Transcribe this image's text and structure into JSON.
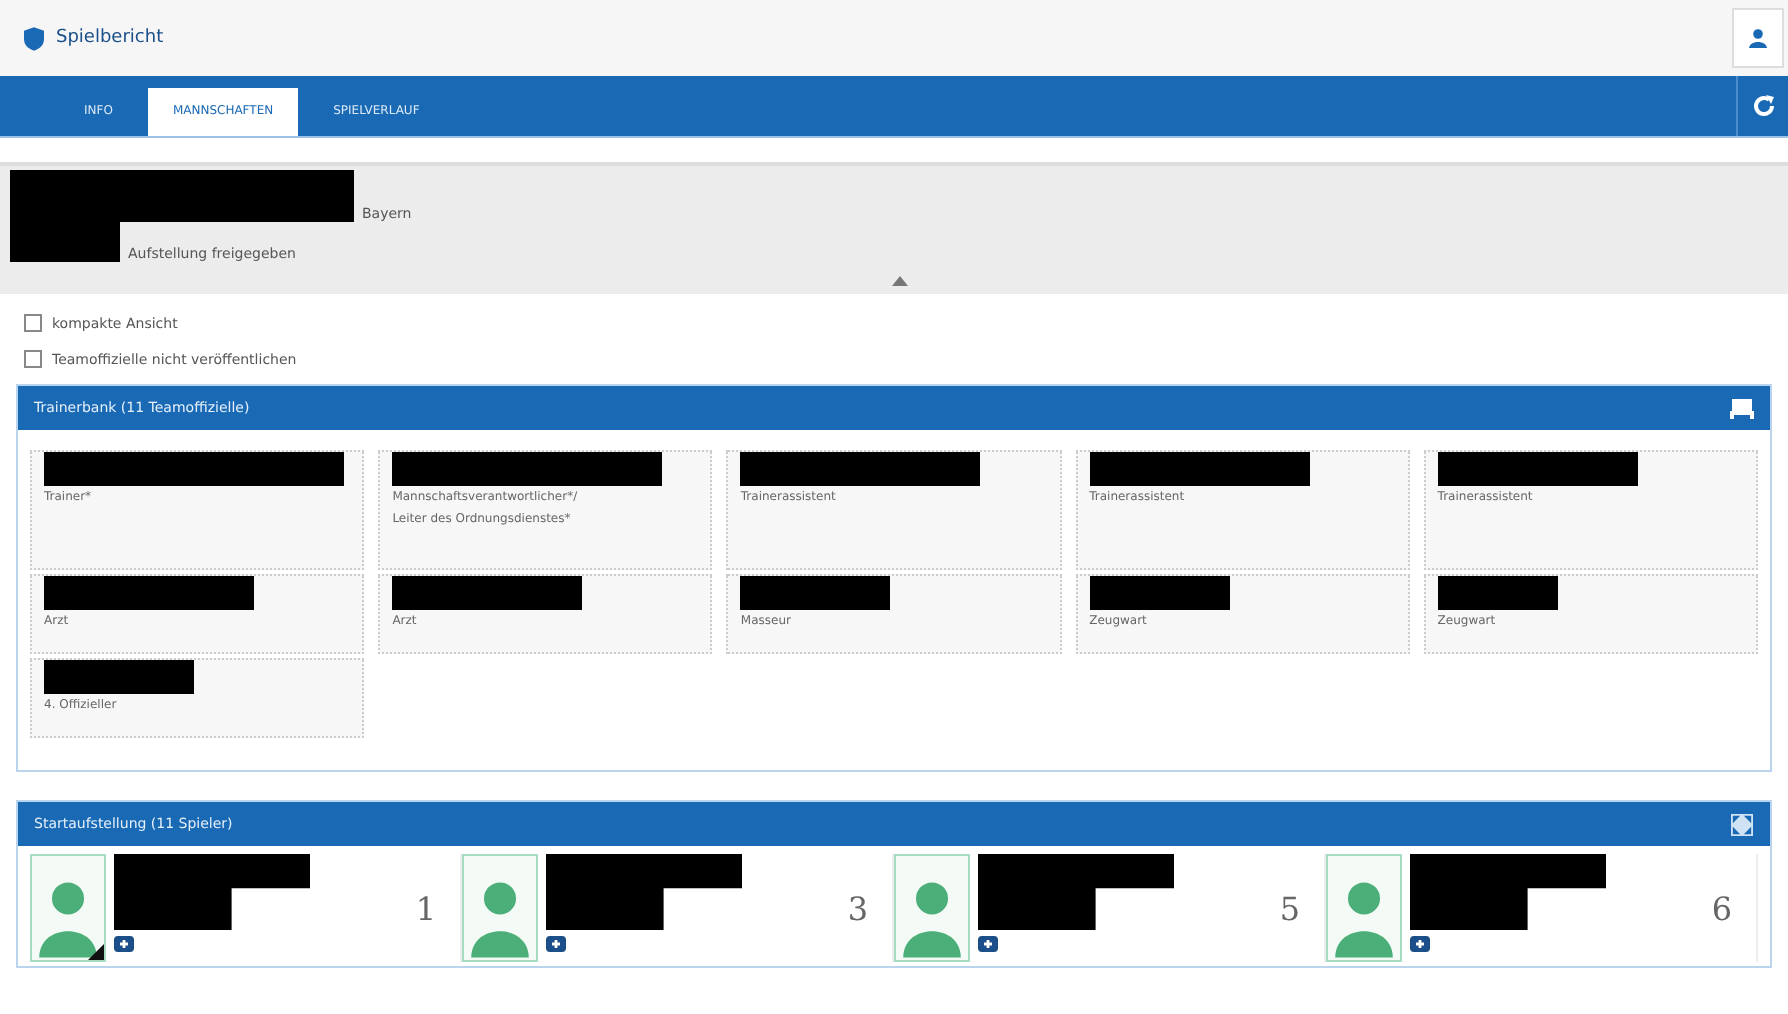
{
  "header": {
    "title": "Spielbericht"
  },
  "tabs": [
    {
      "label": "INFO",
      "selected": false
    },
    {
      "label": "MANNSCHAFTEN",
      "selected": true
    },
    {
      "label": "SPIELVERLAUF",
      "selected": false
    }
  ],
  "match_info": {
    "region": "Bayern",
    "status": "Aufstellung freigegeben"
  },
  "options": [
    {
      "label": "kompakte Ansicht",
      "checked": false
    },
    {
      "label": "Teamoffizielle nicht veröffentlichen",
      "checked": false
    }
  ],
  "bench": {
    "title": "Trainerbank (11 Teamoffizielle)",
    "officials": [
      {
        "roles": [
          "Trainer*"
        ]
      },
      {
        "roles": [
          "Mannschaftsverantwortlicher*/",
          "Leiter des Ordnungsdienstes*"
        ]
      },
      {
        "roles": [
          "Trainerassistent"
        ]
      },
      {
        "roles": [
          "Trainerassistent"
        ]
      },
      {
        "roles": [
          "Trainerassistent"
        ]
      },
      {
        "roles": [
          "Arzt"
        ]
      },
      {
        "roles": [
          "Arzt"
        ]
      },
      {
        "roles": [
          "Masseur"
        ]
      },
      {
        "roles": [
          "Zeugwart"
        ]
      },
      {
        "roles": [
          "Zeugwart"
        ]
      },
      {
        "roles": [
          "4. Offizieller"
        ]
      }
    ]
  },
  "lineup": {
    "title": "Startaufstellung (11 Spieler)",
    "players": [
      {
        "number": "1",
        "captain": true
      },
      {
        "number": "3",
        "captain": false
      },
      {
        "number": "5",
        "captain": false
      },
      {
        "number": "6",
        "captain": false
      }
    ]
  }
}
